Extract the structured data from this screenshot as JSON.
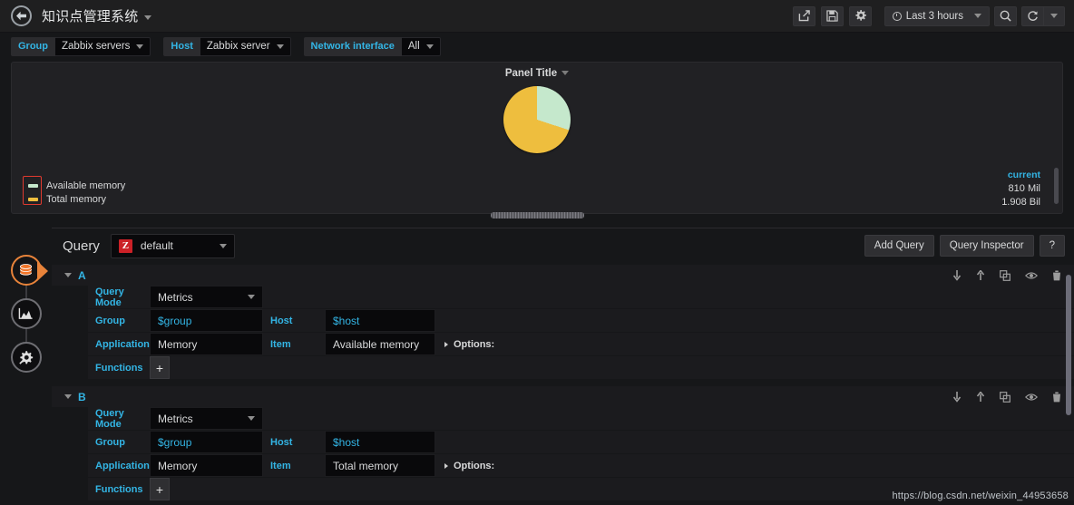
{
  "topnav": {
    "back_icon": "arrow-left-icon",
    "dashboard_title": "知识点管理系统",
    "buttons": [
      {
        "name": "share-dashboard-button",
        "icon": "share-icon"
      },
      {
        "name": "save-dashboard-button",
        "icon": "save-icon"
      },
      {
        "name": "dashboard-settings-button",
        "icon": "gear-icon"
      }
    ],
    "time_range": "Last 3 hours",
    "time_icon": "clock-icon",
    "zoom_out_icon": "search-minus-icon",
    "refresh_icon": "refresh-icon",
    "refresh_caret_icon": "chevron-down-icon"
  },
  "variables": [
    {
      "label": "Group",
      "value": "Zabbix servers"
    },
    {
      "label": "Host",
      "value": "Zabbix server"
    },
    {
      "label": "Network interface",
      "value": "All"
    }
  ],
  "panel": {
    "title": "Panel Title",
    "legend": {
      "columns": [
        "current"
      ],
      "rows": [
        {
          "name": "Available memory",
          "color": "#c5e8cc",
          "current": "810 Mil"
        },
        {
          "name": "Total memory",
          "color": "#eebe3e",
          "current": "1.908 Bil"
        }
      ]
    }
  },
  "chart_data": {
    "type": "pie",
    "title": "Panel Title",
    "labels": [
      "Available memory",
      "Total memory"
    ],
    "values": [
      810,
      1908
    ],
    "value_labels": [
      "810 Mil",
      "1.908 Bil"
    ],
    "colors": [
      "#c5e8cc",
      "#eebe3e"
    ],
    "slice_degrees": [
      108,
      252
    ],
    "legend": "bottom-left",
    "unit": "bytes"
  },
  "editor": {
    "tabs": [
      {
        "name": "editor-tab-queries",
        "icon": "database-icon",
        "active": true
      },
      {
        "name": "editor-tab-visualization",
        "icon": "graph-icon",
        "active": false
      },
      {
        "name": "editor-tab-general",
        "icon": "gear-wrench-icon",
        "active": false
      }
    ],
    "query_label": "Query",
    "datasource": {
      "logo_text": "Z",
      "name": "default"
    },
    "buttons": {
      "add_query": "Add Query",
      "query_inspector": "Query Inspector",
      "help": "?"
    },
    "row_actions": [
      {
        "name": "move-query-down-icon",
        "glyph": "↓"
      },
      {
        "name": "move-query-up-icon",
        "glyph": "↑"
      },
      {
        "name": "duplicate-query-icon",
        "glyph": "❐"
      },
      {
        "name": "toggle-query-visibility-icon",
        "glyph": "👁"
      },
      {
        "name": "delete-query-icon",
        "glyph": "🗑"
      }
    ],
    "labels": {
      "query_mode": "Query Mode",
      "group": "Group",
      "host": "Host",
      "application": "Application",
      "item": "Item",
      "functions": "Functions",
      "options": "Options:",
      "add_function": "+"
    },
    "queries": [
      {
        "letter": "A",
        "query_mode": "Metrics",
        "group": "$group",
        "host": "$host",
        "application": "Memory",
        "item": "Available memory"
      },
      {
        "letter": "B",
        "query_mode": "Metrics",
        "group": "$group",
        "host": "$host",
        "application": "Memory",
        "item": "Total memory"
      }
    ]
  },
  "watermark": "https://blog.csdn.net/weixin_44953658"
}
